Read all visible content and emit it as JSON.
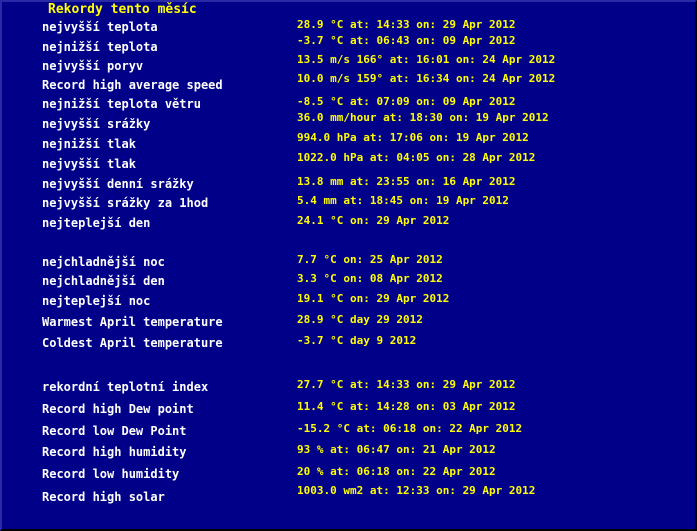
{
  "title": "Rekordy tento měsíc",
  "records": [
    {
      "label": "nejvyšší teplota",
      "value": "28.9 °C   at: 14:33 on: 29 Apr 2012"
    },
    {
      "label": "nejnižší teplota",
      "value": "-3.7 °C   at: 06:43 on: 09 Apr 2012"
    },
    {
      "label": "nejvyšší poryv",
      "value": "13.5 m/s 166° at: 16:01 on: 24 Apr 2012"
    },
    {
      "label": "Record high average speed",
      "value": "10.0 m/s 159° at:  16:34 on: 24 Apr 2012"
    },
    {
      "label": "nejnižší teplota větru",
      "value": "-8.5 °C  at: 07:09 on: 09 Apr 2012"
    },
    {
      "label": "nejvyšší srážky",
      "value": "36.0 mm/hour   at: 18:30 on: 19 Apr 2012"
    },
    {
      "label": "nejnižší tlak",
      "value": "994.0 hPa  at: 17:06 on: 19 Apr 2012"
    },
    {
      "label": "nejvyšší tlak",
      "value": "1022.0 hPa  at: 04:05 on: 28 Apr 2012"
    },
    {
      "label": "nejvyšší denní srážky",
      "value": "13.8 mm    at: 23:55 on: 16 Apr 2012"
    },
    {
      "label": "nejvyšší srážky za 1hod",
      "value": "5.4 mm  at: 18:45 on: 19 Apr 2012"
    },
    {
      "label": "nejteplejší den",
      "value": "24.1 °C    on: 29 Apr 2012"
    },
    {
      "label": "nejchladnější noc",
      "value": "7.7 °C    on: 25 Apr 2012"
    },
    {
      "label": "nejchladnější den",
      "value": "3.3 °C    on: 08 Apr 2012"
    },
    {
      "label": "nejteplejší noc",
      "value": "19.1 °C    on: 29 Apr 2012"
    },
    {
      "label": "Warmest April temperature",
      "value": "28.9 °C day 29 2012"
    },
    {
      "label": "Coldest April temperature",
      "value": "-3.7 °C day 9 2012"
    },
    {
      "label": "rekordní teplotní index",
      "value": "27.7 °C   at: 14:33 on: 29 Apr 2012"
    },
    {
      "label": "Record high Dew point",
      "value": "11.4 °C   at: 14:28 on: 03 Apr 2012"
    },
    {
      "label": "Record low Dew Point",
      "value": "-15.2 °C   at: 06:18 on: 22 Apr 2012"
    },
    {
      "label": "Record high humidity",
      "value": "93 %   at: 06:47 on: 21 Apr 2012"
    },
    {
      "label": "Record low humidity",
      "value": "20 %   at: 06:18 on: 22 Apr 2012"
    },
    {
      "label": "Record high solar",
      "value": "1003.0 wm2  at: 12:33 on: 29 Apr 2012"
    }
  ]
}
